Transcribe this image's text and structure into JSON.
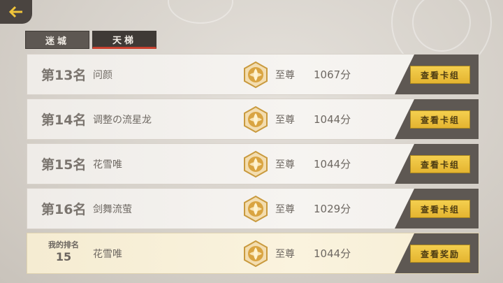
{
  "header": {
    "back_icon": "back-arrow-icon"
  },
  "tabs": [
    {
      "label": "迷城",
      "active": false
    },
    {
      "label": "天梯",
      "active": true
    }
  ],
  "ranking": [
    {
      "rank": "第13名",
      "name": "问颜",
      "tier": "至尊",
      "score": "1067分",
      "action": "查看卡组"
    },
    {
      "rank": "第14名",
      "name": "调整の流星龙",
      "tier": "至尊",
      "score": "1044分",
      "action": "查看卡组"
    },
    {
      "rank": "第15名",
      "name": "花雪唯",
      "tier": "至尊",
      "score": "1044分",
      "action": "查看卡组"
    },
    {
      "rank": "第16名",
      "name": "剑舞流萤",
      "tier": "至尊",
      "score": "1029分",
      "action": "查看卡组"
    }
  ],
  "my_rank": {
    "label": "我的排名",
    "rank": "15",
    "name": "花雪唯",
    "tier": "至尊",
    "score": "1044分",
    "action": "查看奖励"
  },
  "colors": {
    "accent_button": "#e8bb36",
    "tab_active_underline": "#c8412f",
    "badge_gold": "#d9a441"
  }
}
